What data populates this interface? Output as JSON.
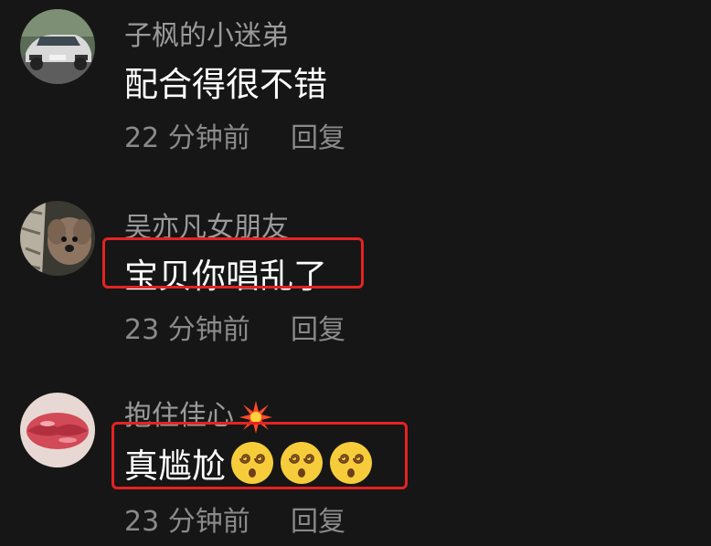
{
  "comments": [
    {
      "avatar_icon": "car-avatar-icon",
      "username": "子枫的小迷弟",
      "content": "配合得很不错",
      "time": "22 分钟前",
      "reply_label": "回复",
      "highlighted": false
    },
    {
      "avatar_icon": "dog-avatar-icon",
      "username": "吴亦凡女朋友",
      "content": "宝贝你唱乱了",
      "time": "23 分钟前",
      "reply_label": "回复",
      "highlighted": true
    },
    {
      "avatar_icon": "lips-avatar-icon",
      "username": "抱住佳心",
      "username_icon": "spark-emoji-icon",
      "content": "真尴尬",
      "content_icons": [
        "dizzy-face-emoji-icon",
        "dizzy-face-emoji-icon",
        "dizzy-face-emoji-icon"
      ],
      "time": "23 分钟前",
      "reply_label": "回复",
      "highlighted": true
    }
  ],
  "colors": {
    "background": "#161616",
    "username": "#9a9a9a",
    "content": "#ffffff",
    "meta": "#8a8a8a",
    "highlight": "#e62222"
  }
}
